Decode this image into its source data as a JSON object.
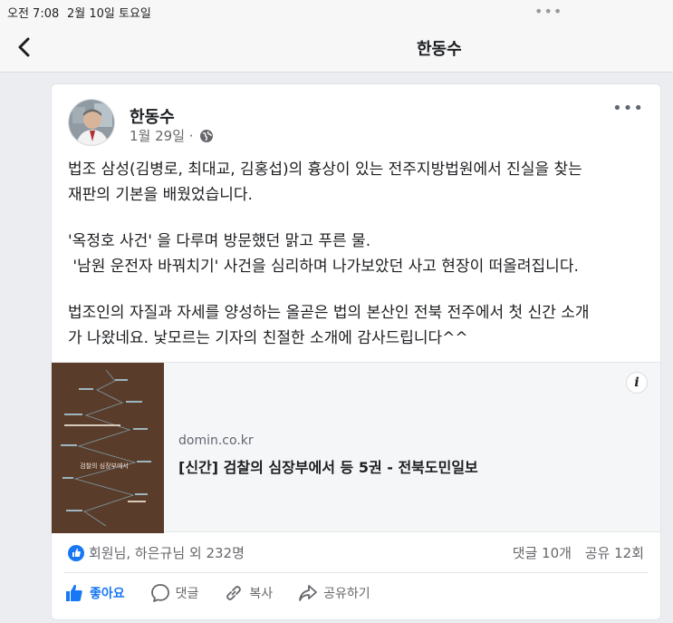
{
  "status_bar": {
    "time": "오전 7:08",
    "date": "2월 10일 토요일",
    "dots": "•••"
  },
  "nav": {
    "title": "한동수"
  },
  "post": {
    "author": "한동수",
    "date": "1월 29일",
    "paragraphs": [
      "법조 삼성(김병로, 최대교, 김홍섭)의 흉상이 있는 전주지방법원에서 진실을 찾는\n재판의 기본을 배웠었습니다.",
      "'옥정호 사건' 을 다루며 방문했던 맑고 푸른 물.\n '남원 운전자 바꿔치기' 사건을 심리하며 나가보았던 사고 현장이 떠올려집니다.",
      "법조인의 자질과 자세를 양성하는 올곧은 법의 본산인 전북 전주에서 첫 신간 소개\n가 나왔네요. 낯모르는 기자의 친절한 소개에 감사드립니다^^"
    ],
    "link": {
      "domain": "domin.co.kr",
      "headline": "[신간] 검찰의 심장부에서 등 5권 - 전북도민일보",
      "info_icon": "i",
      "book_title": "검찰의 심장부에서"
    },
    "reactions": {
      "text": "회원님, 하은규님 외 232명"
    },
    "counts": {
      "comments": "댓글 10개",
      "shares": "공유 12회"
    },
    "actions": {
      "like": "좋아요",
      "comment": "댓글",
      "copy": "복사",
      "share": "공유하기"
    }
  },
  "colors": {
    "accent": "#1877f2",
    "background": "#ebedf0",
    "card": "#ffffff"
  }
}
